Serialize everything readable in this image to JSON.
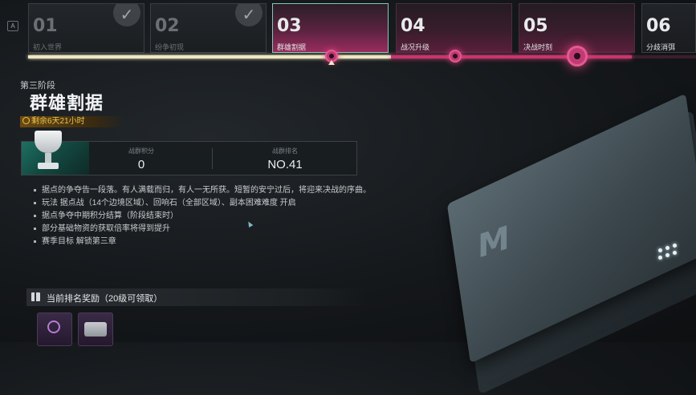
{
  "hud": {
    "key_hint": "A"
  },
  "stages": [
    {
      "num": "01",
      "name": "初入世界",
      "state": "done"
    },
    {
      "num": "02",
      "name": "纷争初现",
      "state": "done"
    },
    {
      "num": "03",
      "name": "群雄割据",
      "state": "active"
    },
    {
      "num": "04",
      "name": "战况升级",
      "state": "locked"
    },
    {
      "num": "05",
      "name": "决战时刻",
      "state": "locked"
    },
    {
      "num": "06",
      "name": "分歧消弭",
      "state": "locked"
    }
  ],
  "stage_info": {
    "subtitle": "第三阶段",
    "title": "群雄割据",
    "timer": "剩余6天21小时"
  },
  "score": {
    "points_label": "战群积分",
    "points_value": "0",
    "rank_label": "战群排名",
    "rank_value": "NO.41"
  },
  "description": [
    "据点的争夺告一段落。有人满载而归，有人一无所获。短暂的安宁过后，将迎来决战的序曲。",
    "玩法  据点战（14个边境区域）、回响石（全部区域）、副本困难难度 开启",
    "据点争夺中期积分结算（阶段结束时）",
    "部分基础物资的获取倍率将得到提升",
    "赛季目标  解锁第三章"
  ],
  "rewards": {
    "title": "当前排名奖励（20级可领取）",
    "items": [
      {
        "icon": "emblem-icon"
      },
      {
        "icon": "chest-icon"
      }
    ]
  },
  "colors": {
    "accent_pink": "#c8356f",
    "progress": "#efe6c4",
    "timer_gold": "#f0c64a",
    "active_border": "#7fc8b8"
  }
}
